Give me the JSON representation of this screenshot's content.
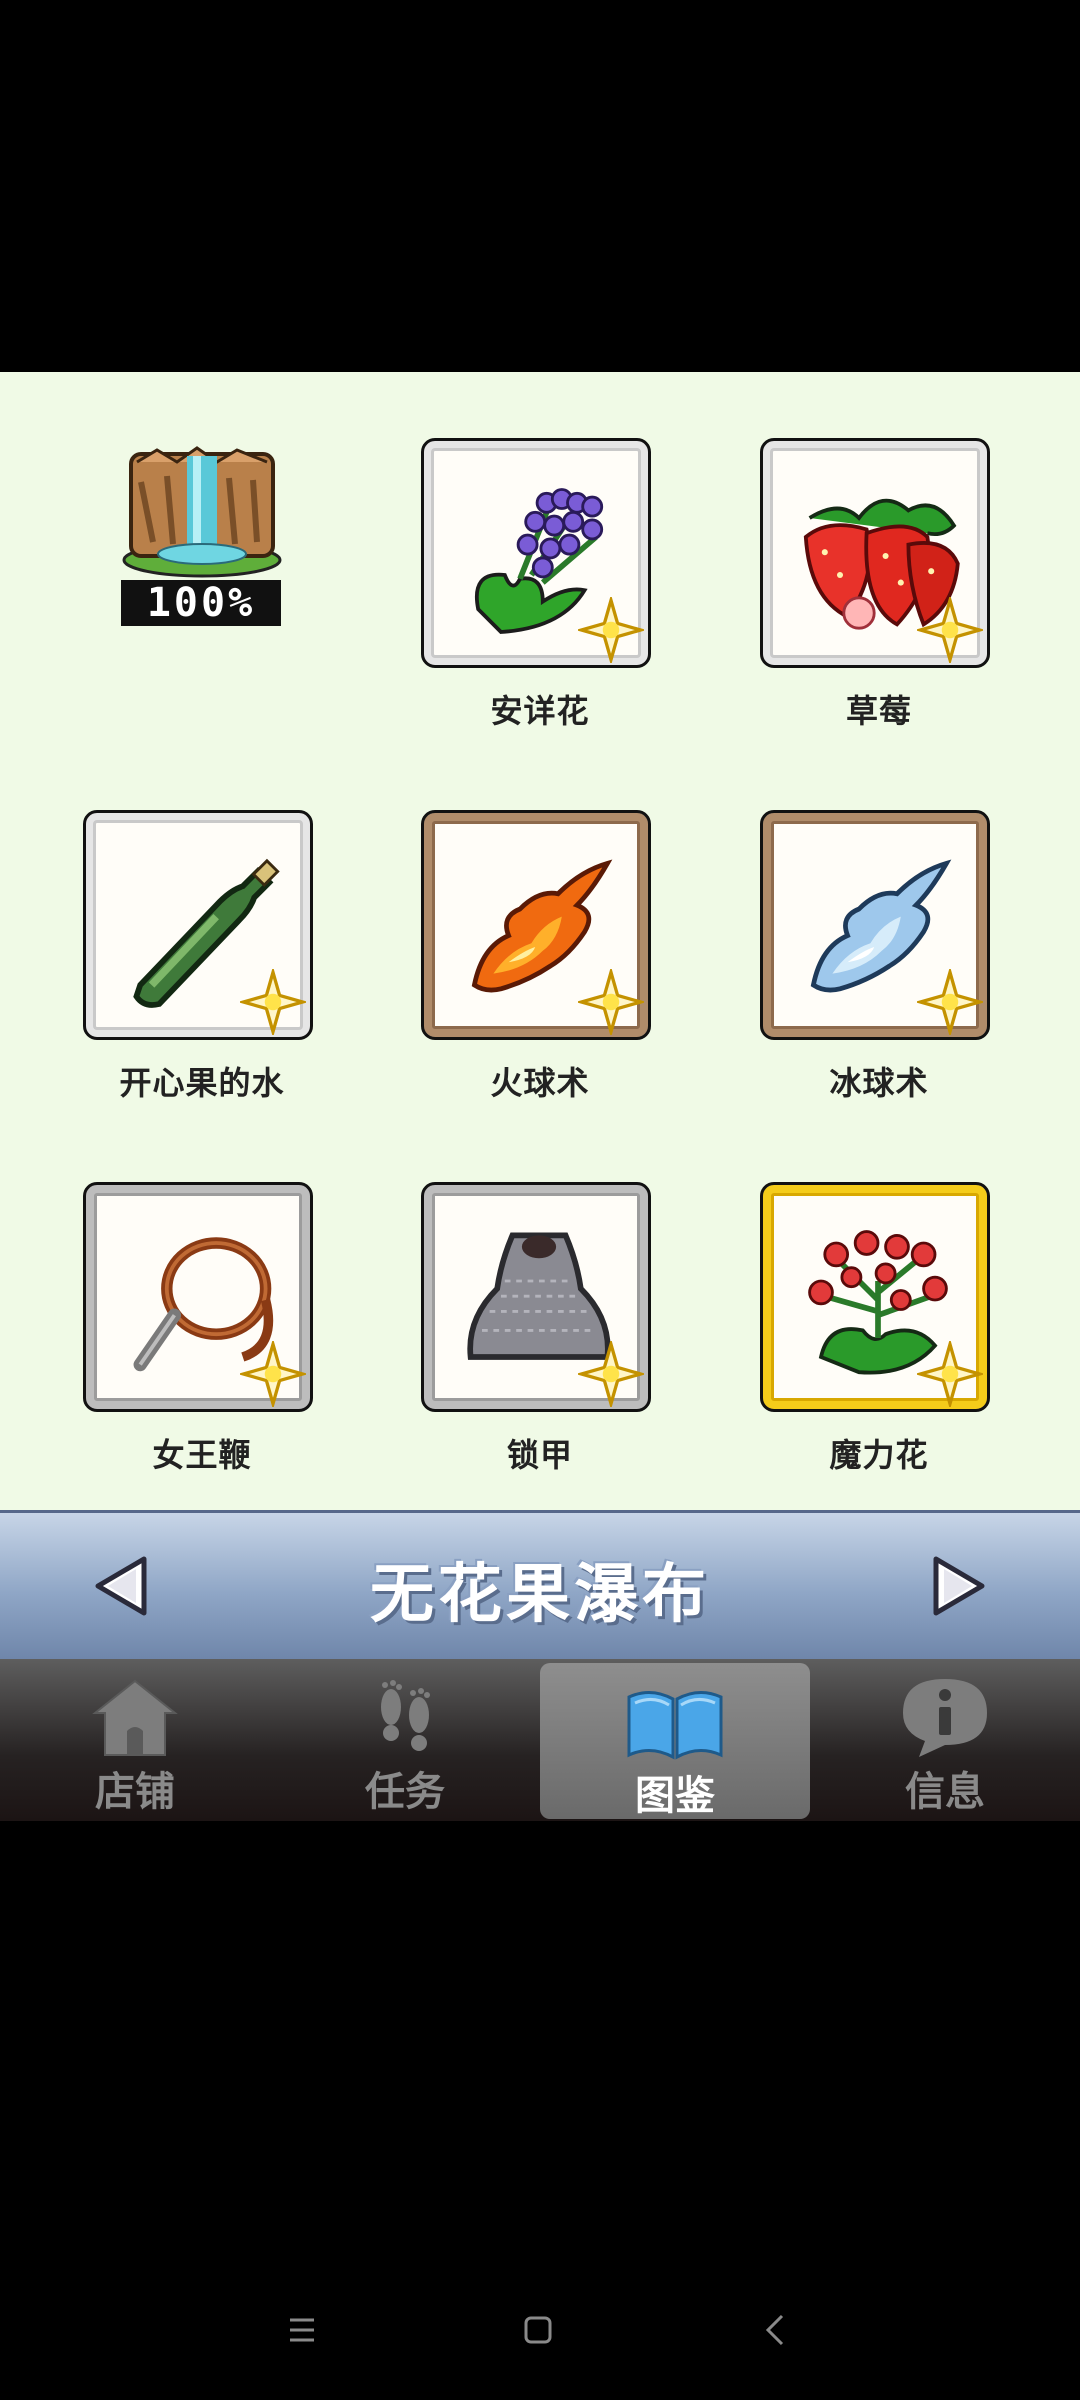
{
  "collection": {
    "completion_percent": "100%",
    "completion_icon": "waterfall-cliff-icon",
    "items": [
      {
        "name": "安详花",
        "icon": "purple-flower-icon",
        "frame": "white"
      },
      {
        "name": "草莓",
        "icon": "strawberry-icon",
        "frame": "white"
      },
      {
        "name": "开心果的水",
        "icon": "green-bottle-icon",
        "frame": "white"
      },
      {
        "name": "火球术",
        "icon": "fireball-icon",
        "frame": "brown"
      },
      {
        "name": "冰球术",
        "icon": "iceball-icon",
        "frame": "brown"
      },
      {
        "name": "女王鞭",
        "icon": "whip-icon",
        "frame": "gray"
      },
      {
        "name": "锁甲",
        "icon": "chainmail-icon",
        "frame": "gray"
      },
      {
        "name": "魔力花",
        "icon": "red-berry-plant-icon",
        "frame": "gold"
      }
    ]
  },
  "area": {
    "title": "无花果瀑布",
    "prev_icon": "left-arrow-icon",
    "next_icon": "right-arrow-icon"
  },
  "tabs": [
    {
      "label": "店铺",
      "icon": "house-icon",
      "active": false
    },
    {
      "label": "任务",
      "icon": "footprints-icon",
      "active": false
    },
    {
      "label": "图鉴",
      "icon": "open-book-icon",
      "active": true
    },
    {
      "label": "信息",
      "icon": "info-bubble-icon",
      "active": false
    }
  ],
  "system_nav": {
    "menu_icon": "menu-icon",
    "home_icon": "square-home-icon",
    "back_icon": "back-chevron-icon"
  }
}
